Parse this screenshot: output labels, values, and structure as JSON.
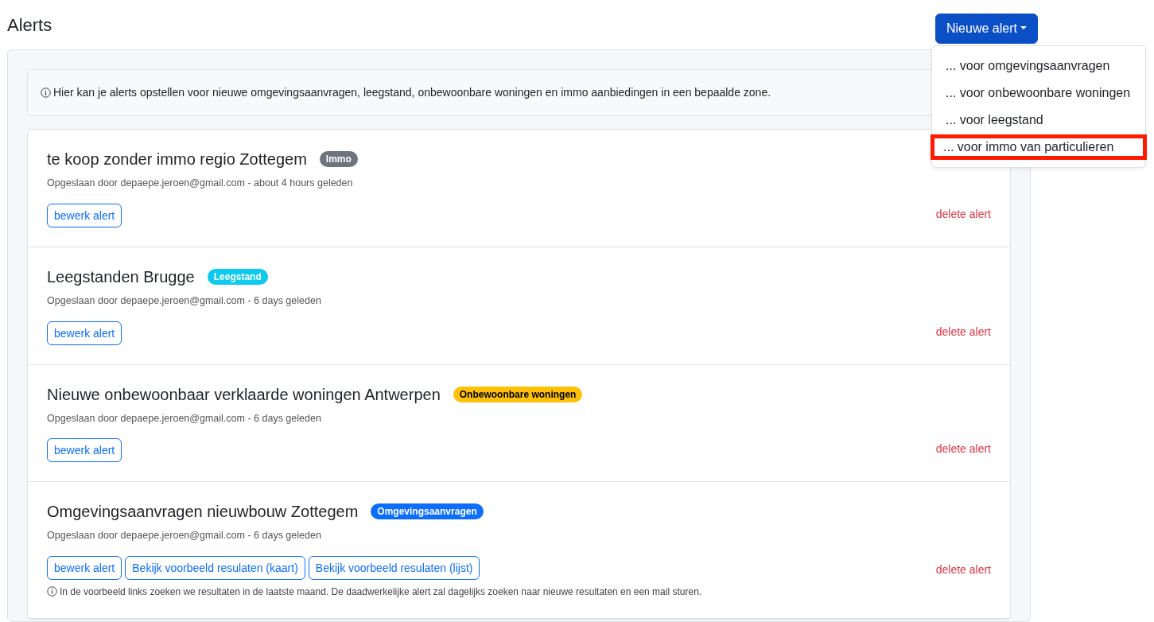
{
  "page_title": "Alerts",
  "new_button": {
    "label": "Nieuwe alert",
    "expanded": true
  },
  "menu": [
    {
      "label": "... voor omgevingsaanvragen",
      "highlighted": false
    },
    {
      "label": "... voor onbewoonbare woningen",
      "highlighted": false
    },
    {
      "label": "... voor leegstand",
      "highlighted": false
    },
    {
      "label": "... voor immo van particulieren",
      "highlighted": true
    }
  ],
  "info": "Hier kan je alerts opstellen voor nieuwe omgevingsaanvragen, leegstand, onbewoonbare woningen en immo aanbiedingen in een bepaalde zone.",
  "alerts": [
    {
      "title": "te koop zonder immo regio Zottegem",
      "badge": {
        "label": "Immo",
        "color": "#6c757d"
      },
      "meta": "Opgeslaan door depaepe.jeroen@gmail.com - about 4 hours geleden",
      "buttons": [
        "bewerk alert"
      ],
      "delete": "delete alert"
    },
    {
      "title": "Leegstanden Brugge",
      "badge": {
        "label": "Leegstand",
        "color": "#0dcaf0"
      },
      "meta": "Opgeslaan door depaepe.jeroen@gmail.com - 6 days geleden",
      "buttons": [
        "bewerk alert"
      ],
      "delete": "delete alert"
    },
    {
      "title": "Nieuwe onbewoonbaar verklaarde woningen Antwerpen",
      "badge": {
        "label": "Onbewoonbare woningen",
        "color": "#ffc107"
      },
      "meta": "Opgeslaan door depaepe.jeroen@gmail.com - 6 days geleden",
      "buttons": [
        "bewerk alert"
      ],
      "delete": "delete alert"
    },
    {
      "title": "Omgevingsaanvragen nieuwbouw Zottegem",
      "badge": {
        "label": "Omgevingsaanvragen",
        "color": "#0d6efd"
      },
      "meta": "Opgeslaan door depaepe.jeroen@gmail.com - 6 days geleden",
      "buttons": [
        "bewerk alert",
        "Bekijk voorbeeld resulaten (kaart)",
        "Bekijk voorbeeld resulaten (lijst)"
      ],
      "note": "In de voorbeeld links zoeken we resultaten in de laatste maand. De daadwerkelijke alert zal dagelijks zoeken naar nieuwe resultaten en een mail sturen.",
      "delete": "delete alert"
    }
  ]
}
